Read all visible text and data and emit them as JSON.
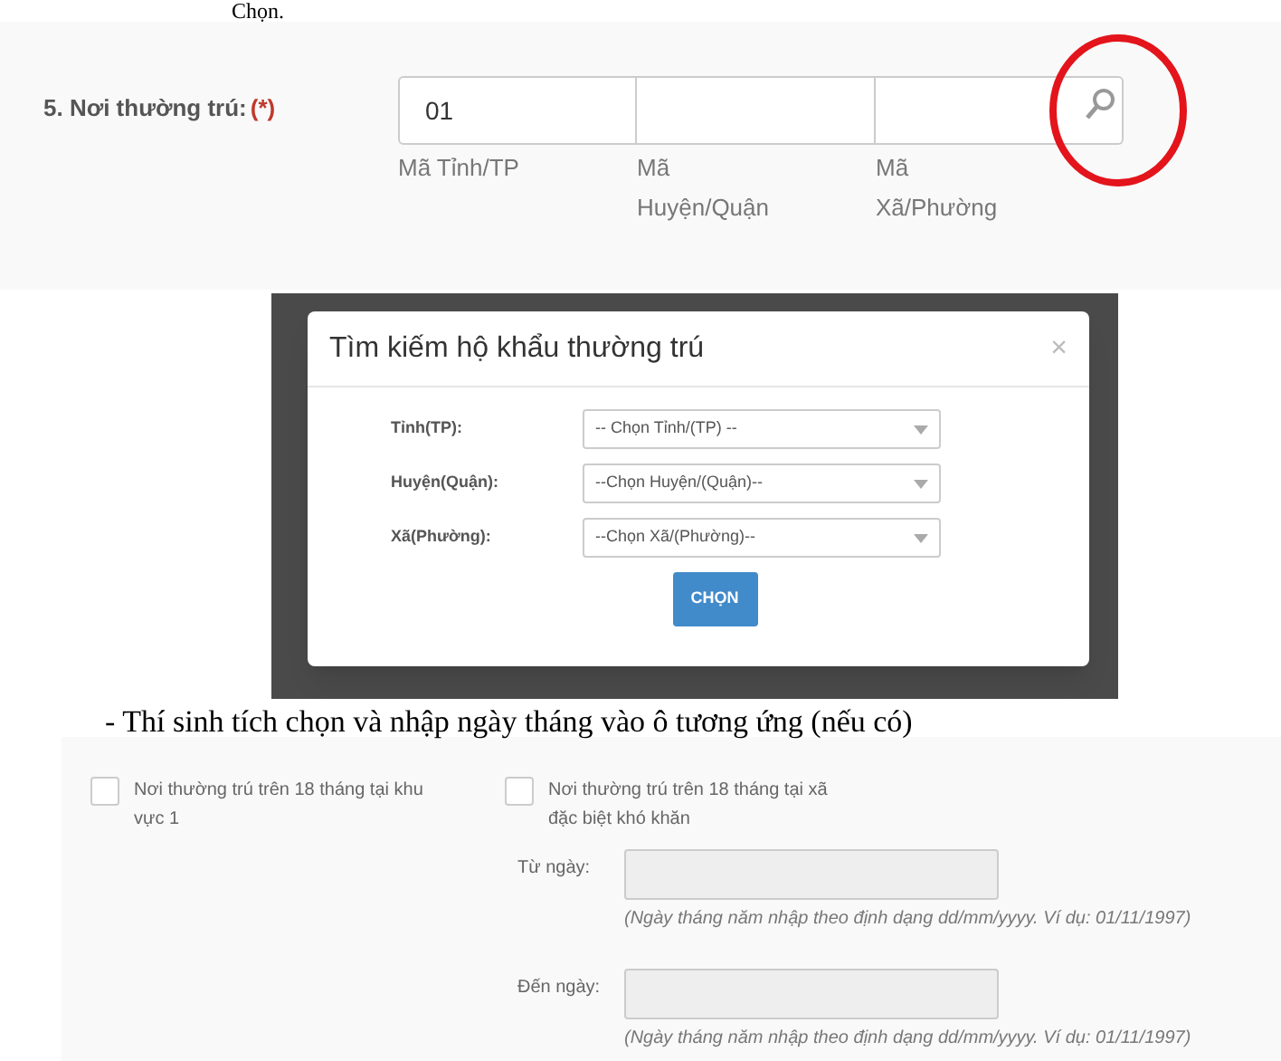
{
  "doc_top_text": "Chọn.",
  "residence": {
    "label": "5. Nơi thường trú:",
    "required_mark": "(*)",
    "fields": [
      {
        "value": "01",
        "caption": "Mã Tỉnh/TP"
      },
      {
        "caption": "Mã Huyện/Quận"
      },
      {
        "caption": "Mã Xã/Phường"
      }
    ]
  },
  "dialog": {
    "title": "Tìm kiếm hộ khẩu thường trú",
    "close": "×",
    "rows": [
      {
        "label": "Tỉnh(TP):",
        "value": "-- Chọn Tỉnh/(TP) --"
      },
      {
        "label": "Huyện(Quận):",
        "value": "--Chọn Huyện/(Quận)--"
      },
      {
        "label": "Xã(Phường):",
        "value": "--Chọn Xã/(Phường)--"
      }
    ],
    "button": "CHỌN"
  },
  "instruction": "- Thí sinh tích chọn và nhập ngày tháng vào ô tương ứng (nếu có)",
  "checkboxes": [
    {
      "label": "Nơi thường trú trên 18 tháng tại khu vực 1",
      "checked": false
    },
    {
      "label": "Nơi thường trú trên 18 tháng tại xã đặc biệt khó khăn",
      "checked": false
    }
  ],
  "dates": [
    {
      "label": "Từ ngày:",
      "hint": "(Ngày tháng năm nhập theo định dạng dd/mm/yyyy. Ví dụ: 01/11/1997)"
    },
    {
      "label": "Đến ngày:",
      "hint": "(Ngày tháng năm nhập theo định dạng dd/mm/yyyy. Ví dụ: 01/11/1997)"
    }
  ]
}
